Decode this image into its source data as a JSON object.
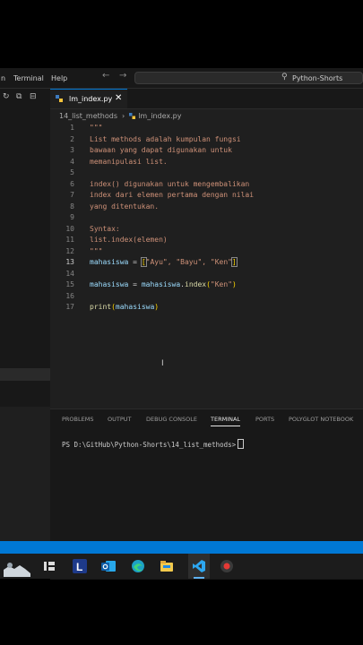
{
  "titlebar": {
    "menu": [
      "n",
      "Terminal",
      "Help"
    ],
    "nav_back": "←",
    "nav_forward": "→",
    "search_text": "Python-Shorts"
  },
  "sidebar": {
    "buttons": [
      "↻",
      "⧉",
      "⊟"
    ]
  },
  "tab": {
    "name": "lm_index.py",
    "close": "✕"
  },
  "breadcrumb": {
    "folder": "14_list_methods",
    "separator": "›",
    "file": "lm_index.py"
  },
  "code": {
    "lines": [
      {
        "n": "1",
        "text": "\"\"\""
      },
      {
        "n": "2",
        "text": "List methods adalah kumpulan fungsi"
      },
      {
        "n": "3",
        "text": "bawaan yang dapat digunakan untuk"
      },
      {
        "n": "4",
        "text": "memanipulasi list."
      },
      {
        "n": "5",
        "text": ""
      },
      {
        "n": "6",
        "text": "index() digunakan untuk mengembalikan"
      },
      {
        "n": "7",
        "text": "index dari elemen pertama dengan nilai"
      },
      {
        "n": "8",
        "text": "yang ditentukan."
      },
      {
        "n": "9",
        "text": ""
      },
      {
        "n": "10",
        "text": "Syntax:"
      },
      {
        "n": "11",
        "text": "list.index(elemen)"
      },
      {
        "n": "12",
        "text": "\"\"\""
      },
      {
        "n": "13",
        "var": "mahasiswa",
        "op": " = ",
        "open": "[",
        "items": "\"Ayu\", \"Bayu\", \"Ken\"",
        "close": "]"
      },
      {
        "n": "14",
        "text": ""
      },
      {
        "n": "15",
        "var": "mahasiswa",
        "op": " = ",
        "obj": "mahasiswa",
        "dot": ".",
        "fn": "index",
        "p1": "(",
        "arg": "\"Ken\"",
        "p2": ")"
      },
      {
        "n": "16",
        "text": ""
      },
      {
        "n": "17",
        "fn": "print",
        "p1": "(",
        "arg": "mahasiswa",
        "p2": ")"
      }
    ]
  },
  "panel": {
    "tabs": [
      "PROBLEMS",
      "OUTPUT",
      "DEBUG CONSOLE",
      "TERMINAL",
      "PORTS",
      "POLYGLOT NOTEBOOK"
    ],
    "active_tab": "TERMINAL",
    "prompt": "PS D:\\GitHub\\Python-Shorts\\14_list_methods>"
  },
  "taskbar": {
    "apps": [
      "widgets",
      "task-view",
      "lark",
      "outlook",
      "edge",
      "file-explorer",
      "vscode",
      "recorder"
    ],
    "active": "vscode",
    "accent": "#5fb2f2"
  },
  "colors": {
    "statusbar": "#0078d4",
    "string": "#ce9178",
    "variable": "#9cdcfe",
    "function": "#dcdcaa"
  }
}
